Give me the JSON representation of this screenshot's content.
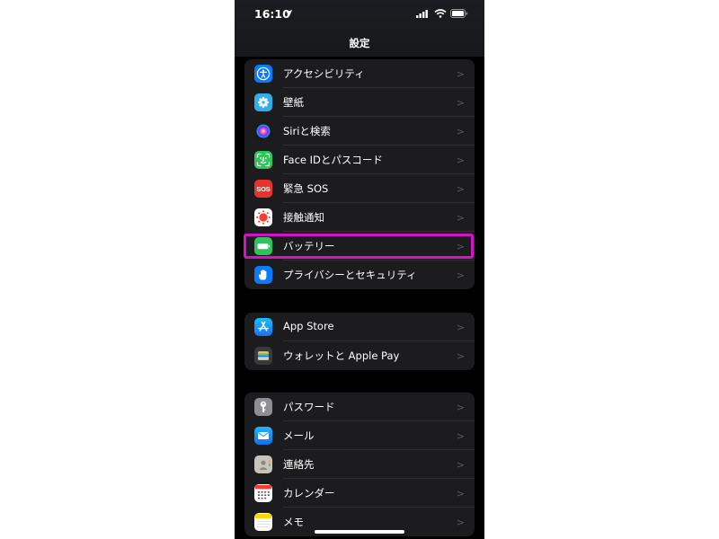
{
  "status_bar": {
    "time": "16:10"
  },
  "nav": {
    "title": "設定"
  },
  "groups": [
    {
      "items": [
        {
          "label": "アクセシビリティ",
          "icon": "accessibility-icon",
          "color": "#0a7aff"
        },
        {
          "label": "壁紙",
          "icon": "wallpaper-icon",
          "color": "#32ade6"
        },
        {
          "label": "Siriと検索",
          "icon": "siri-icon",
          "color": "#1a1a1a"
        },
        {
          "label": "Face IDとパスコード",
          "icon": "face-id-icon",
          "color": "#30c35a"
        },
        {
          "label": "緊急 SOS",
          "icon": "sos-icon",
          "color": "#e5342e",
          "icon_text": "SOS"
        },
        {
          "label": "接触通知",
          "icon": "exposure-notification-icon",
          "color": "#ffffff"
        },
        {
          "label": "バッテリー",
          "icon": "battery-icon",
          "color": "#30c35a"
        },
        {
          "label": "プライバシーとセキュリティ",
          "icon": "privacy-hand-icon",
          "color": "#0a7aff"
        }
      ]
    },
    {
      "items": [
        {
          "label": "App Store",
          "icon": "app-store-icon",
          "color": "#1e90ff"
        },
        {
          "label": "ウォレットと Apple Pay",
          "icon": "wallet-icon",
          "color": "#3a3a3c"
        }
      ]
    },
    {
      "items": [
        {
          "label": "パスワード",
          "icon": "key-icon",
          "color": "#8e8e93"
        },
        {
          "label": "メール",
          "icon": "mail-icon",
          "color": "#1e8cf5"
        },
        {
          "label": "連絡先",
          "icon": "contacts-icon",
          "color": "#c8c3bb"
        },
        {
          "label": "カレンダー",
          "icon": "calendar-icon",
          "color": "#ffffff"
        },
        {
          "label": "メモ",
          "icon": "notes-icon",
          "color": "#ffffff"
        }
      ]
    }
  ],
  "highlight_color": "#d413c6"
}
